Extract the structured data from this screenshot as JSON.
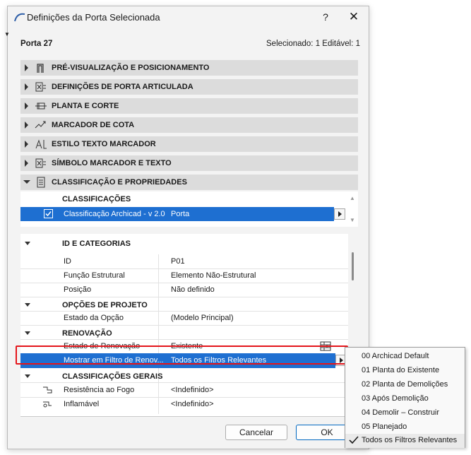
{
  "window": {
    "title": "Definições da Porta Selecionada",
    "help_label": "?",
    "close_label": "✕"
  },
  "header": {
    "element_name": "Porta 27",
    "selection_info": "Selecionado: 1 Editável: 1"
  },
  "sections": [
    {
      "label": "PRÉ-VISUALIZAÇÃO E POSICIONAMENTO",
      "icon": "door-frame-icon"
    },
    {
      "label": "DEFINIÇÕES DE PORTA ARTICULADA",
      "icon": "door-settings-icon"
    },
    {
      "label": "PLANTA E CORTE",
      "icon": "plan-section-icon"
    },
    {
      "label": "MARCADOR DE COTA",
      "icon": "dimension-marker-icon"
    },
    {
      "label": "ESTILO TEXTO MARCADOR",
      "icon": "text-style-icon"
    },
    {
      "label": "SÍMBOLO MARCADOR E TEXTO",
      "icon": "marker-symbol-icon"
    },
    {
      "label": "CLASSIFICAÇÃO E PROPRIEDADES",
      "icon": "classification-icon"
    }
  ],
  "classifications": {
    "header": "CLASSIFICAÇÕES",
    "row_label": "Classificação Archicad - v 2.0",
    "row_value": "Porta"
  },
  "groups": {
    "id_categories": "ID E CATEGORIAS",
    "project_options": "OPÇÕES DE PROJETO",
    "renovation": "RENOVAÇÃO",
    "general_classifications": "CLASSIFICAÇÕES GERAIS"
  },
  "properties": [
    {
      "key": "ID",
      "value": "P01"
    },
    {
      "key": "Função Estrutural",
      "value": "Elemento Não-Estrutural"
    },
    {
      "key": "Posição",
      "value": "Não definido"
    },
    {
      "key": "Estado da Opção",
      "value": "(Modelo Principal)"
    },
    {
      "key": "Estado de Renovação",
      "value": "Existente"
    },
    {
      "key": "Mostrar em Filtro de Renov...",
      "value": "Todos os Filtros Relevantes"
    },
    {
      "key": "Resistência ao Fogo",
      "value": "<Indefinido>"
    },
    {
      "key": "Inflamável",
      "value": "<Indefinido>"
    }
  ],
  "dropdown_options": [
    "00 Archicad Default",
    "01 Planta do Existente",
    "02 Planta de Demolições",
    "03 Após Demolição",
    "04 Demolir – Construir",
    "05 Planejado",
    "Todos os Filtros Relevantes"
  ],
  "buttons": {
    "cancel": "Cancelar",
    "ok": "OK"
  },
  "colors": {
    "selection": "#1e6fd1",
    "highlight_border": "#e4151b",
    "section_bg": "#dcdcdc"
  }
}
